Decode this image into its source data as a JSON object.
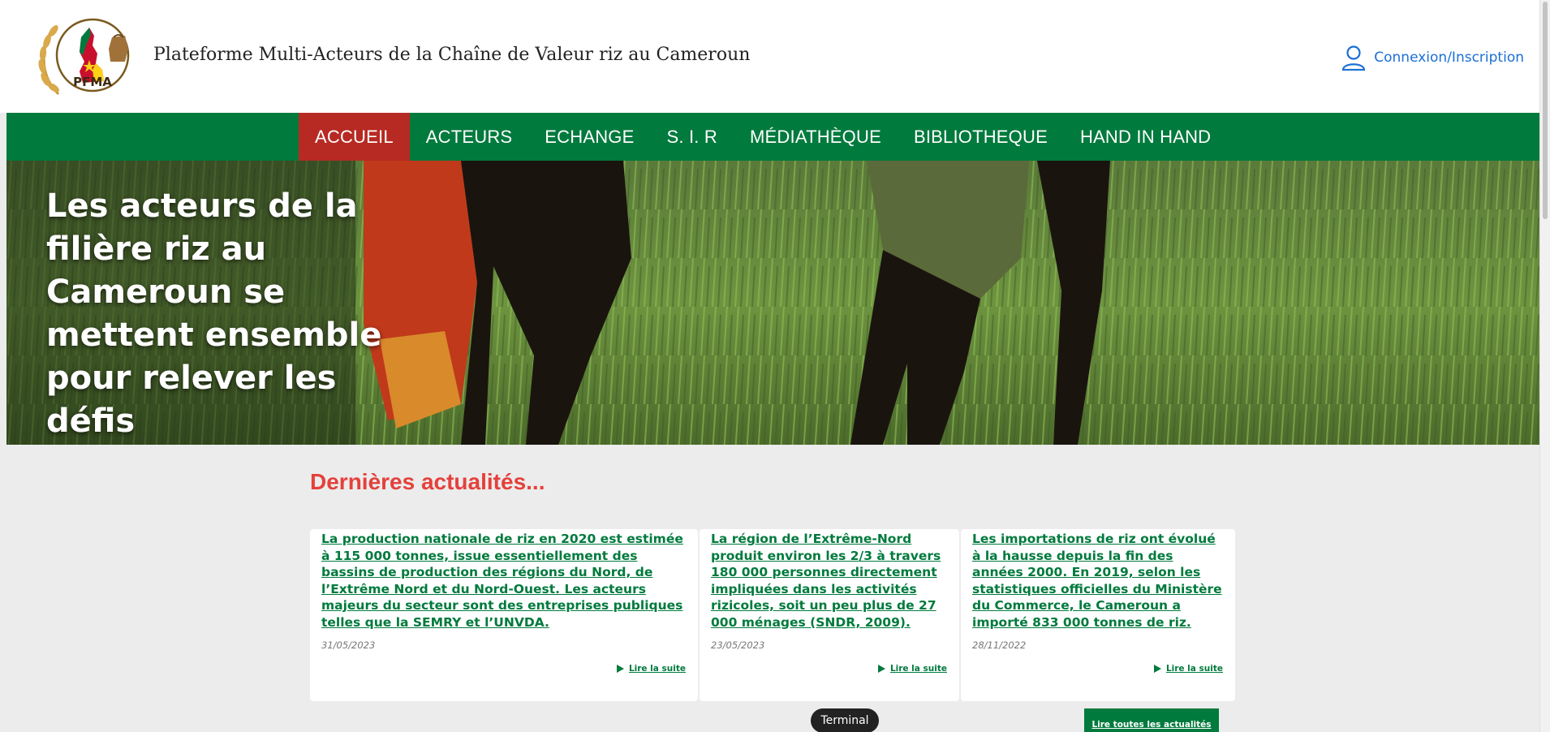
{
  "header": {
    "logo_text": "PFMA",
    "site_title": "Plateforme Multi-Acteurs de la Chaîne de Valeur riz au Cameroun",
    "login_label": "Connexion/Inscription"
  },
  "nav": {
    "items": [
      {
        "label": "ACCUEIL",
        "active": true
      },
      {
        "label": "ACTEURS"
      },
      {
        "label": "ECHANGE"
      },
      {
        "label": "S. I. R"
      },
      {
        "label": "MÉDIATHÈQUE"
      },
      {
        "label": "BIBLIOTHEQUE"
      },
      {
        "label": "HAND IN HAND"
      }
    ]
  },
  "hero": {
    "title": "Les acteurs de la filière riz au Cameroun se mettent ensemble pour relever les défis"
  },
  "news": {
    "heading": "Dernières actualités...",
    "cards": [
      {
        "title": "La production nationale de riz en 2020 est estimée à 115 000 tonnes, issue essentiellement des bassins de production des régions du Nord, de l’Extrême Nord et du Nord-Ouest. Les acteurs majeurs du secteur sont des entreprises publiques telles que la SEMRY et l’UNVDA.",
        "date": "31/05/2023",
        "more": "Lire la suite"
      },
      {
        "title": "La région de l’Extrême-Nord produit environ les 2/3 à travers 180 000 personnes directement impliquées dans les activités rizicoles, soit un peu plus de 27 000 ménages (SNDR, 2009).",
        "date": "23/05/2023",
        "more": "Lire la suite"
      },
      {
        "title": "Les importations de riz ont évolué à la hausse depuis la fin des années 2000. En 2019, selon les statistiques officielles du Ministère du Commerce, le Cameroun a importé 833 000 tonnes de riz.",
        "date": "28/11/2022",
        "more": "Lire la suite"
      }
    ],
    "all_label": "Lire toutes les actualités"
  },
  "overlay": {
    "terminal_label": "Terminal"
  },
  "colors": {
    "brand_green": "#007a3d",
    "active_red": "#b72a23",
    "heading_red": "#e4413c",
    "link_blue": "#1a6fd6"
  }
}
